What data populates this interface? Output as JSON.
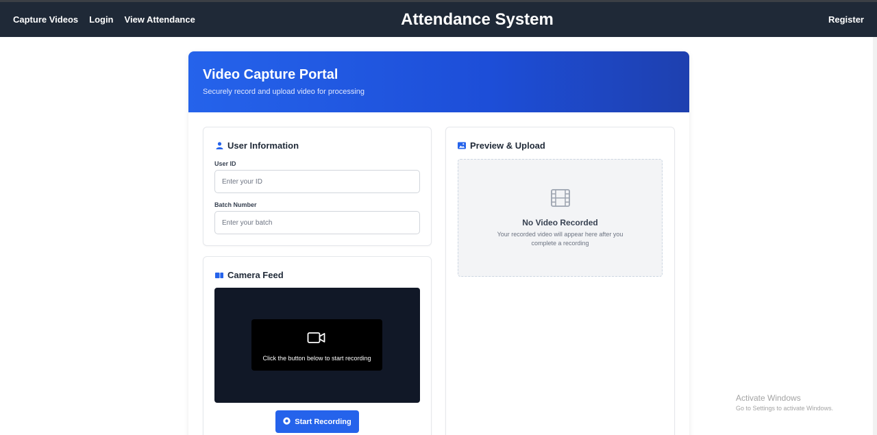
{
  "navbar": {
    "links": [
      "Capture Videos",
      "Login",
      "View Attendance"
    ],
    "brand": "Attendance System",
    "register": "Register"
  },
  "hero": {
    "title": "Video Capture Portal",
    "subtitle": "Securely record and upload video for processing"
  },
  "user_info": {
    "title": "User Information",
    "user_id_label": "User ID",
    "user_id_placeholder": "Enter your ID",
    "user_id_value": "",
    "batch_label": "Batch Number",
    "batch_placeholder": "Enter your batch",
    "batch_value": ""
  },
  "camera": {
    "title": "Camera Feed",
    "overlay_text": "Click the button below to start recording",
    "start_label": "Start Recording"
  },
  "preview": {
    "title": "Preview & Upload",
    "empty_title": "No Video Recorded",
    "empty_text": "Your recorded video will appear here after you complete a recording"
  },
  "watermark": {
    "title": "Activate Windows",
    "subtitle": "Go to Settings to activate Windows."
  },
  "colors": {
    "navbar": "#1f2937",
    "accent": "#2563eb",
    "camera_bg": "#111827"
  },
  "icons": [
    "user-icon",
    "camera-feed-icon",
    "image-icon",
    "video-camera-icon",
    "film-icon",
    "record-icon"
  ]
}
